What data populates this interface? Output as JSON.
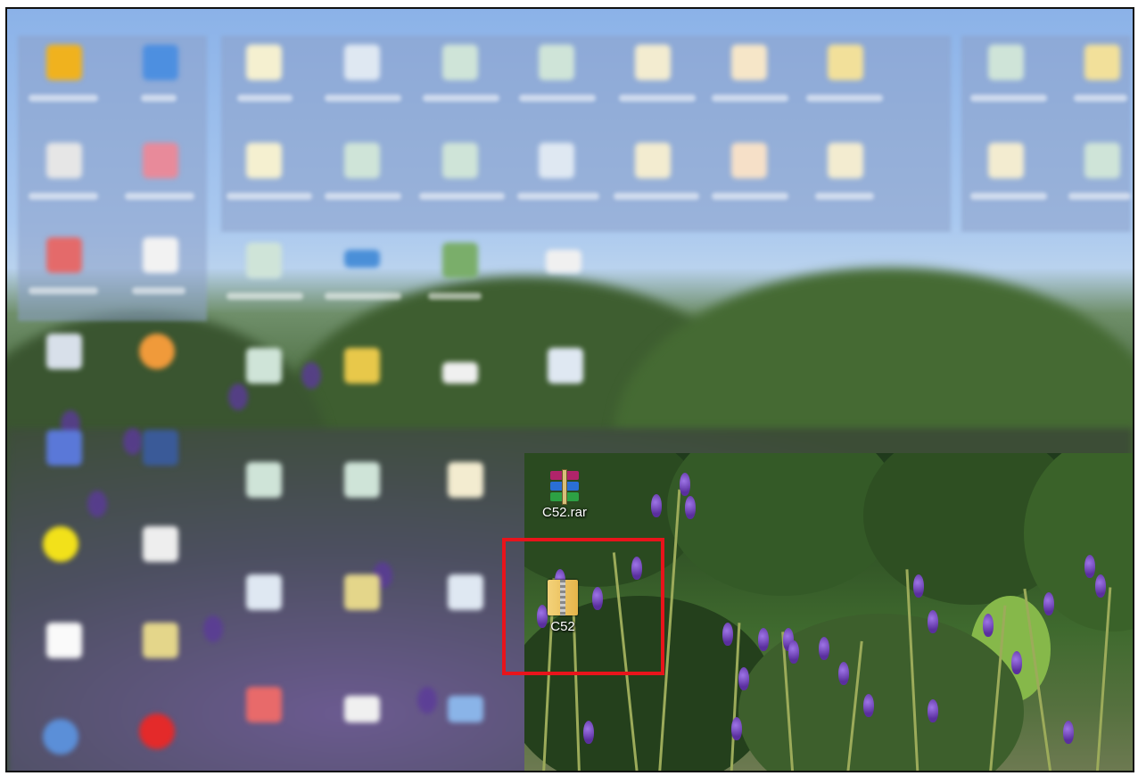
{
  "desktop": {
    "icons": [
      {
        "label": "C52.rar",
        "icon": "winrar-archive-icon"
      },
      {
        "label": "C52",
        "icon": "zip-folder-icon"
      }
    ],
    "highlight_color": "#e8141b"
  }
}
